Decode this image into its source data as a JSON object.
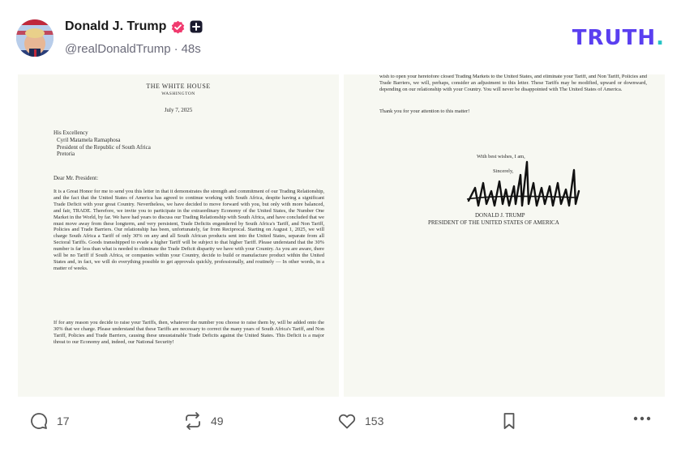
{
  "post": {
    "author_name": "Donald J. Trump",
    "handle": "@realDonaldTrump",
    "separator": "·",
    "time_ago": "48s",
    "verified_icon": "verified-badge-icon",
    "verified_color": "#f03a6e"
  },
  "brand": {
    "logo_text": "TRUTH",
    "logo_dot": ".",
    "logo_color": "#5a3ff0",
    "logo_dot_color": "#26c3c5"
  },
  "letter_page1": {
    "heading": "THE WHITE HOUSE",
    "city": "WASHINGTON",
    "date": "July 7, 2025",
    "addressee": [
      "His Excellency",
      "Cyril Matamela Ramaphosa",
      "President of the Republic of South Africa",
      "Pretoria"
    ],
    "salutation": "Dear Mr. President:",
    "paragraph1": "It is a Great Honor for me to send you this letter in that it demonstrates the strength and commitment of our Trading Relationship, and the fact that the United States of America has agreed to continue working with South Africa, despite having a significant Trade Deficit with your great Country. Nevertheless, we have decided to move forward with you, but only with more balanced, and fair, TRADE. Therefore, we invite you to participate in the extraordinary Economy of the United States, the Number One Market in the World, by far. We have had years to discuss our Trading Relationship with South Africa, and have concluded that we must move away from these longterm, and very persistent, Trade Deficits engendered by South Africa's Tariff, and Non Tariff, Policies and Trade Barriers. Our relationship has been, unfortunately, far from Reciprocal. Starting on August 1, 2025, we will charge South Africa a Tariff of only 30% on any and all South African products sent into the United States, separate from all Sectoral Tariffs. Goods transshipped to evade a higher Tariff will be subject to that higher Tariff. Please understand that the 30% number is far less than what is needed to eliminate the Trade Deficit disparity we have with your Country. As you are aware, there will be no Tariff if South Africa, or companies within your Country, decide to build or manufacture product within the United States and, in fact, we will do everything possible to get approvals quickly, professionally, and routinely — In other words, in a matter of weeks.",
    "paragraph2": "If for any reason you decide to raise your Tariffs, then, whatever the number you choose to raise them by, will be added onto the 30% that we charge. Please understand that these Tariffs are necessary to correct the many years of South Africa's Tariff, and Non Tariff, Policies and Trade Barriers, causing these unsustainable Trade Deficits against the United States. This Deficit is a major threat to our Economy and, indeed, our National Security!"
  },
  "letter_page2": {
    "continued": "wish to open your heretofore closed Trading Markets to the United States, and eliminate your Tariff, and Non Tariff, Policies and Trade Barriers, we will, perhaps, consider an adjustment to this letter. These Tariffs may be modified, upward or downward, depending on our relationship with your Country. You will never be disappointed with The United States of America.",
    "thanks": "Thank you for your attention to this matter!",
    "closing": "With best wishes, I am,",
    "sincerely": "Sincerely,",
    "signer_name": "DONALD J. TRUMP",
    "signer_title": "PRESIDENT OF THE UNITED STATES OF AMERICA"
  },
  "actions": {
    "reply_count": "17",
    "retruth_count": "49",
    "like_count": "153",
    "reply_icon": "reply-bubble-icon",
    "retruth_icon": "retruth-icon",
    "like_icon": "heart-icon",
    "save_icon": "bookmark-icon",
    "more_icon": "more-dots-icon"
  }
}
